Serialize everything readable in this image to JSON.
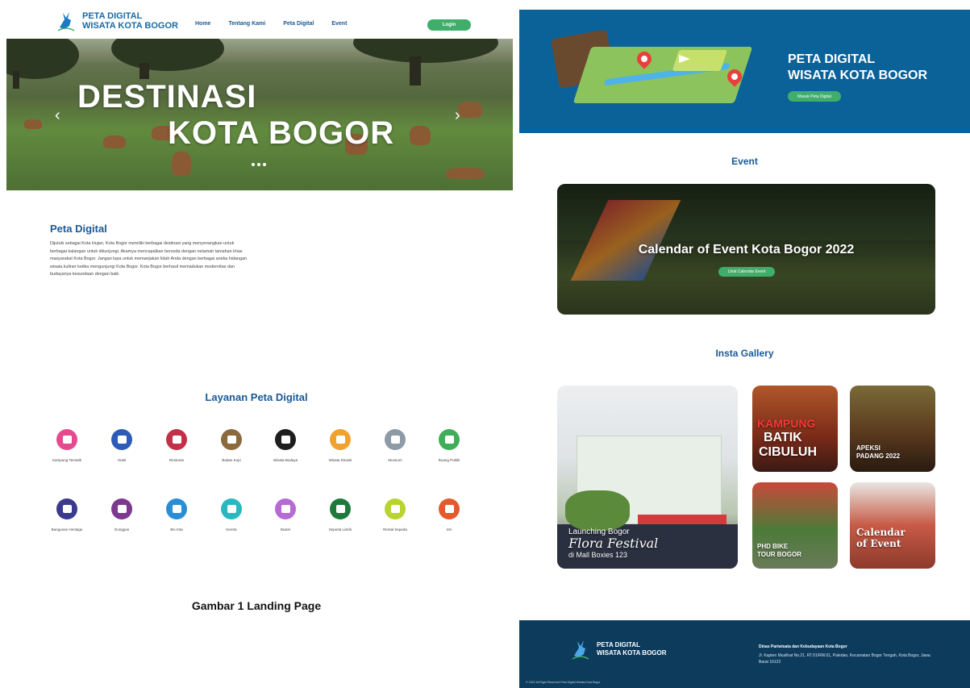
{
  "left": {
    "brand": {
      "line1": "PETA DIGITAL",
      "line2": "WISATA KOTA BOGOR"
    },
    "nav": {
      "items": [
        {
          "label": "Home"
        },
        {
          "label": "Tentang Kami"
        },
        {
          "label": "Peta Digital"
        },
        {
          "label": "Event"
        }
      ],
      "login_label": "Login"
    },
    "hero": {
      "line1": "DESTINASI",
      "line2": "KOTA BOGOR",
      "prev_glyph": "‹",
      "next_glyph": "›",
      "slide_count": 3
    },
    "peta_digital": {
      "title": "Peta Digital",
      "body": "Dijuluki sebagai Kota Hujan, Kota Bogor memiliki berbagai destinasi yang menyenangkan untuk berbagai kalangan untuk dikunjungi. Akamya mencapalkan bersoda dengan nelamah tamahan khas masyarakat Kota Bogor. Jangan lupa untuk memanjakan lidah Anda dengan berbagai aneka hidangan wisata kuliner ketika mengunjungi Kota Bogor. Kota Bogor berhasil memadukan modernitas dan budayanya kesundaan dengan baik."
    },
    "layanan_title": "Layanan Peta Digital",
    "services": [
      {
        "label": "Kampung Tematik",
        "color": "#e64a8e",
        "icon": "house-icon"
      },
      {
        "label": "Hotel",
        "color": "#2d5bb8",
        "icon": "hotel-icon"
      },
      {
        "label": "Restoran",
        "color": "#c2304a",
        "icon": "restaurant-icon"
      },
      {
        "label": "Badan Kopi",
        "color": "#8b6a3e",
        "icon": "coffee-icon"
      },
      {
        "label": "Wisata Budaya",
        "color": "#1e1e1e",
        "icon": "culture-icon"
      },
      {
        "label": "Wisata Dinasti",
        "color": "#f0a22e",
        "icon": "dynasty-icon"
      },
      {
        "label": "Museum",
        "color": "#8e9aa6",
        "icon": "museum-icon"
      },
      {
        "label": "Ruang Publik",
        "color": "#3fae5a",
        "icon": "public-space-icon"
      },
      {
        "label": "Bangunan Heritage",
        "color": "#3a3a8e",
        "icon": "heritage-icon"
      },
      {
        "label": "Gongpan",
        "color": "#7b3a8e",
        "icon": "gongpan-icon"
      },
      {
        "label": "Bis Kita",
        "color": "#2a8ed4",
        "icon": "bus-icon"
      },
      {
        "label": "Kereta",
        "color": "#2ab8c0",
        "icon": "train-icon"
      },
      {
        "label": "Skuter",
        "color": "#b56ad4",
        "icon": "scooter-icon"
      },
      {
        "label": "Sepeda Listrik",
        "color": "#1e7a3a",
        "icon": "ebike-icon"
      },
      {
        "label": "Rental Sepeda",
        "color": "#b8d42e",
        "icon": "bicycle-icon"
      },
      {
        "label": "Izin",
        "color": "#e25a2e",
        "icon": "permit-icon"
      }
    ],
    "caption": "Gambar 1 Landing Page"
  },
  "right": {
    "banner": {
      "line1": "PETA DIGITAL",
      "line2": "WISATA KOTA BOGOR",
      "button_label": "Masuk Peta Digital"
    },
    "event_title": "Event",
    "event_card": {
      "title": "Calendar of Event Kota Bogor 2022",
      "button_label": "Lihat Calendar Event"
    },
    "gallery_title": "Insta Gallery",
    "gallery": [
      {
        "line1": "Launching Bogor",
        "line2": "Flora Festival",
        "line3": "di Mall Boxies 123"
      },
      {
        "line1": "KAMPUNG",
        "line2": "BATIK",
        "line3": "CIBULUH"
      },
      {
        "line1": "APEKSI",
        "line2": "PADANG 2022"
      },
      {
        "line1": "PHD BIKE",
        "line2": "TOUR BOGOR"
      },
      {
        "line1": "Calendar",
        "line2": "of Event"
      }
    ],
    "footer": {
      "brand_line1": "PETA DIGITAL",
      "brand_line2": "WISATA KOTA BOGOR",
      "org": "Dinas Pariwisata dan Kebudayaan Kota Bogor",
      "address": "Jl. Kapten Muslihat No.21, RT.01/RW.01, Paledan, Kecamatan Bogor Tengah, Kota Bogor, Jawa Barat 16122",
      "copyright": "© 2022 All Right Reserved Peta Digital Wisata Kota Bogor"
    }
  }
}
